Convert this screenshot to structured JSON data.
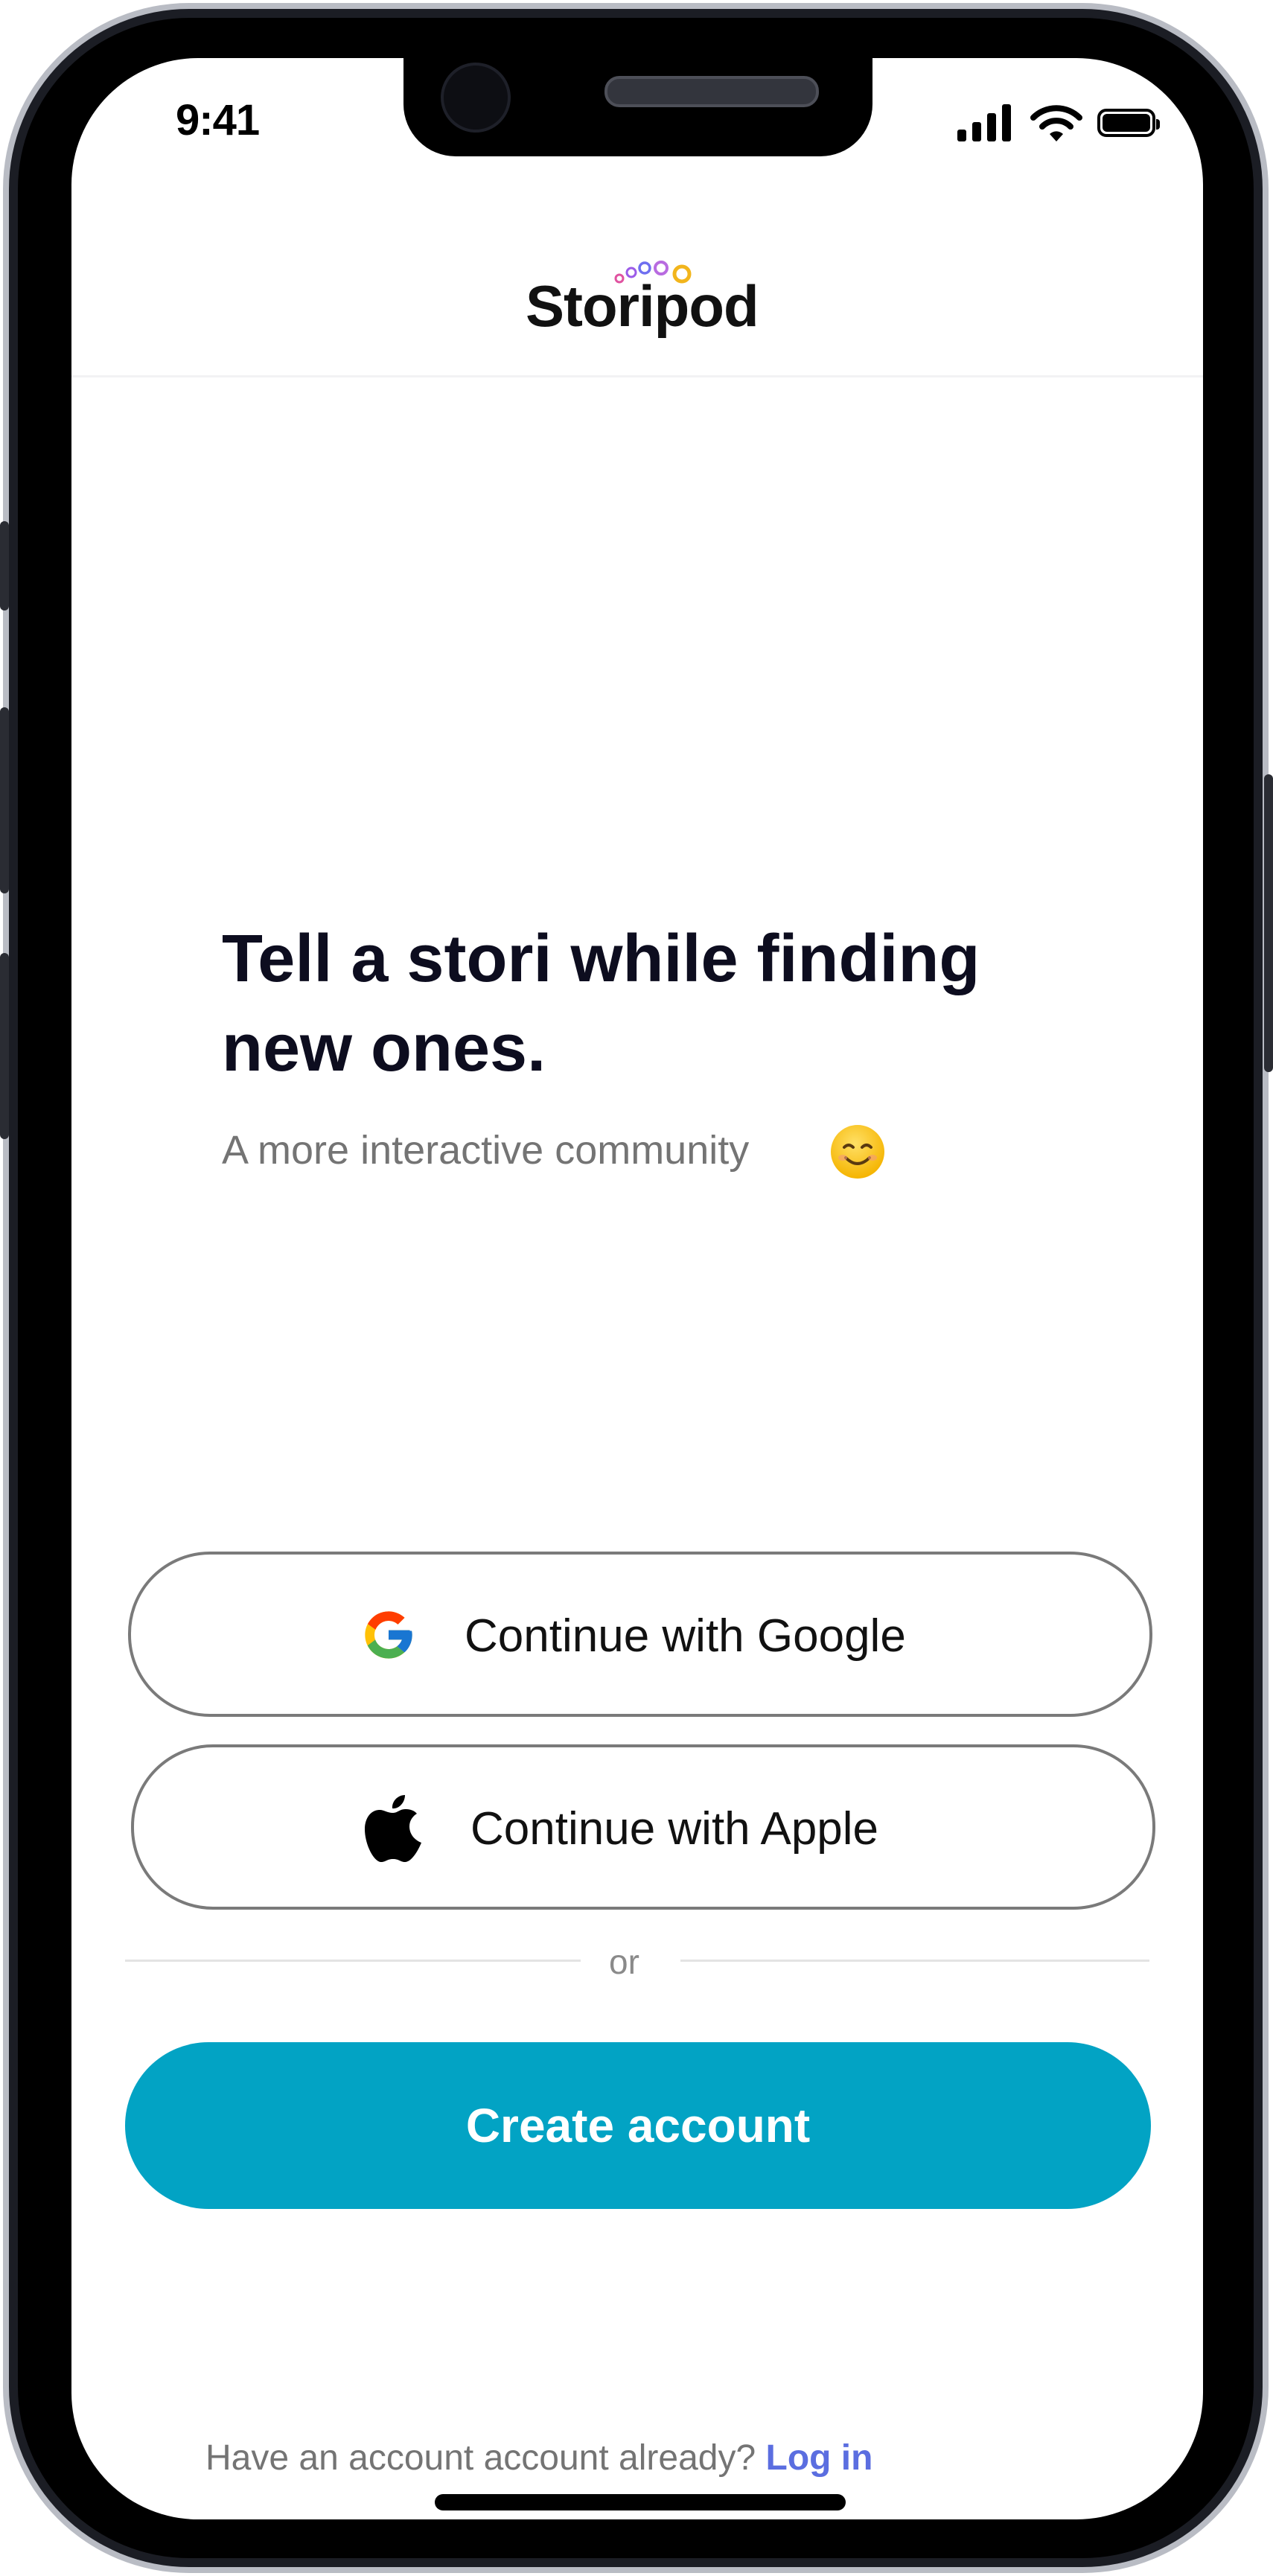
{
  "status_bar": {
    "time": "9:41"
  },
  "header": {
    "logo_text": "Storipod"
  },
  "hero": {
    "headline": "Tell a stori while finding new ones.",
    "subtitle": "A more interactive community",
    "emoji": "smiling-face"
  },
  "auth": {
    "google_label": "Continue with Google",
    "apple_label": "Continue with Apple",
    "divider_text": "or",
    "create_account_label": "Create account",
    "login_prompt": "Have an account account already?",
    "login_link": "Log in"
  },
  "colors": {
    "accent": "#02A3C4",
    "link": "#5B6EE0",
    "headline": "#0D0D1F",
    "muted": "#747474"
  }
}
